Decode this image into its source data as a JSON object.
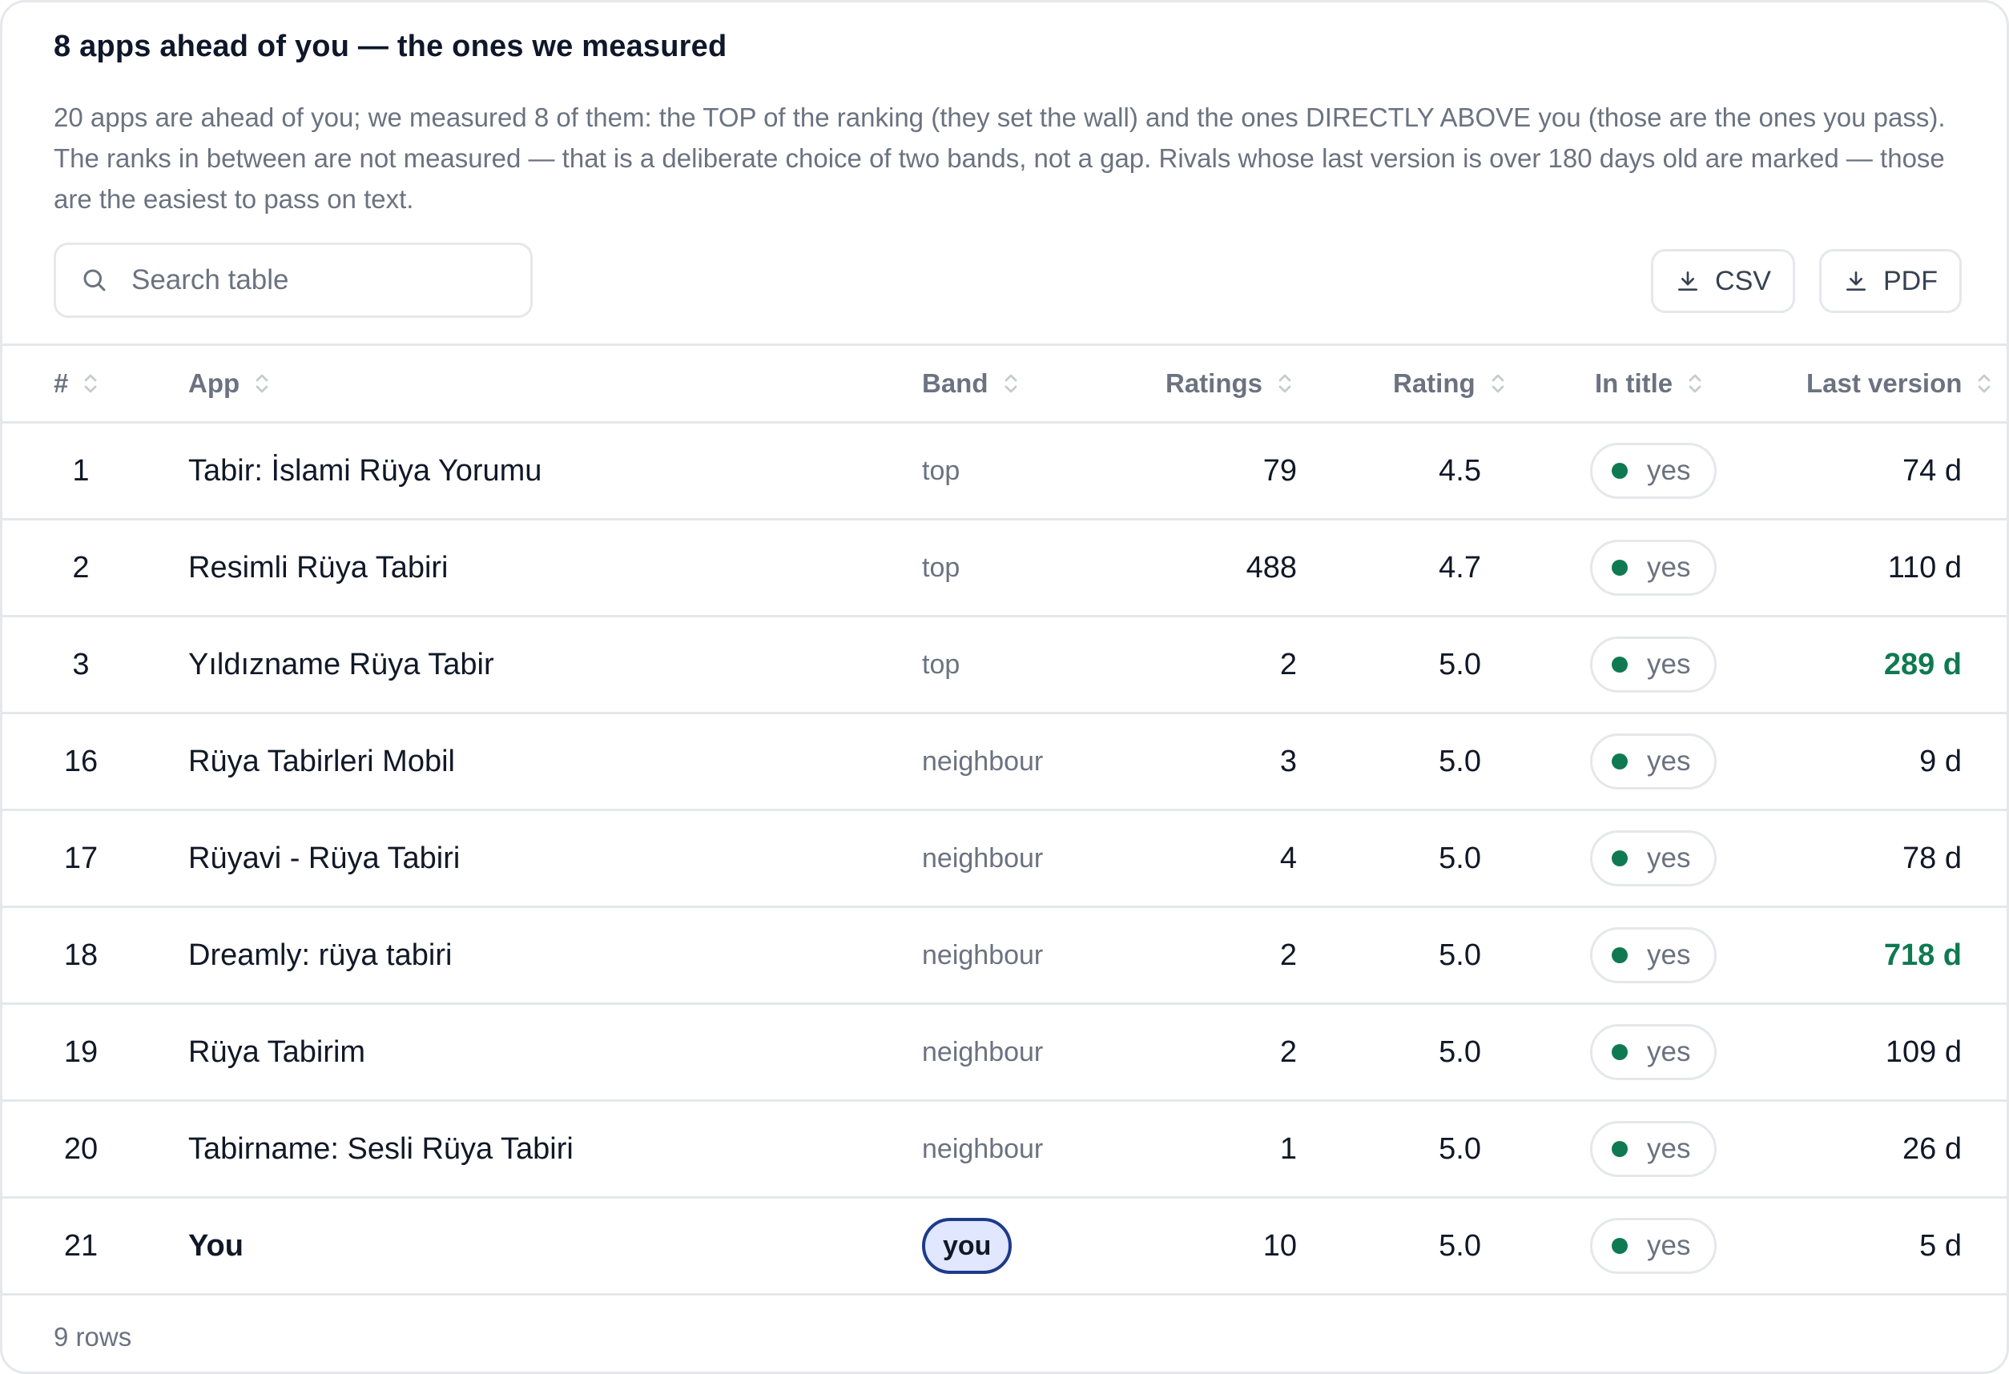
{
  "header": {
    "title": "8 apps ahead of you — the ones we measured",
    "description": "20 apps are ahead of you; we measured 8 of them: the TOP of the ranking (they set the wall) and the ones DIRECTLY ABOVE you (those are the ones you pass). The ranks in between are not measured — that is a deliberate choice of two bands, not a gap. Rivals whose last version is over 180 days old are marked — those are the easiest to pass on text."
  },
  "toolbar": {
    "search_placeholder": "Search table",
    "csv_label": "CSV",
    "pdf_label": "PDF"
  },
  "table": {
    "columns": {
      "rank": "#",
      "app": "App",
      "band": "Band",
      "ratings": "Ratings",
      "rating": "Rating",
      "in_title": "In title",
      "last_version": "Last version"
    },
    "rows": [
      {
        "rank": "1",
        "app": "Tabir: İslami Rüya Yorumu",
        "band": "top",
        "ratings": "79",
        "rating": "4.5",
        "in_title": "yes",
        "last_version": "74 d"
      },
      {
        "rank": "2",
        "app": "Resimli Rüya Tabiri",
        "band": "top",
        "ratings": "488",
        "rating": "4.7",
        "in_title": "yes",
        "last_version": "110 d"
      },
      {
        "rank": "3",
        "app": "Yıldızname Rüya Tabir",
        "band": "top",
        "ratings": "2",
        "rating": "5.0",
        "in_title": "yes",
        "last_version": "289 d"
      },
      {
        "rank": "16",
        "app": "Rüya Tabirleri Mobil",
        "band": "neighbour",
        "ratings": "3",
        "rating": "5.0",
        "in_title": "yes",
        "last_version": "9 d"
      },
      {
        "rank": "17",
        "app": "Rüyavi - Rüya Tabiri",
        "band": "neighbour",
        "ratings": "4",
        "rating": "5.0",
        "in_title": "yes",
        "last_version": "78 d"
      },
      {
        "rank": "18",
        "app": "Dreamly: rüya tabiri",
        "band": "neighbour",
        "ratings": "2",
        "rating": "5.0",
        "in_title": "yes",
        "last_version": "718 d"
      },
      {
        "rank": "19",
        "app": "Rüya Tabirim",
        "band": "neighbour",
        "ratings": "2",
        "rating": "5.0",
        "in_title": "yes",
        "last_version": "109 d"
      },
      {
        "rank": "20",
        "app": "Tabirname: Sesli Rüya Tabiri",
        "band": "neighbour",
        "ratings": "1",
        "rating": "5.0",
        "in_title": "yes",
        "last_version": "26 d"
      },
      {
        "rank": "21",
        "app": "You",
        "band": "you",
        "ratings": "10",
        "rating": "5.0",
        "in_title": "yes",
        "last_version": "5 d"
      }
    ]
  },
  "footer": {
    "row_count": "9 rows"
  },
  "colors": {
    "stale_accent": "#0f7a52",
    "you_badge_border": "#1e3a8a",
    "you_badge_fill": "#e0e7ff",
    "dot": "#0f7a52"
  }
}
